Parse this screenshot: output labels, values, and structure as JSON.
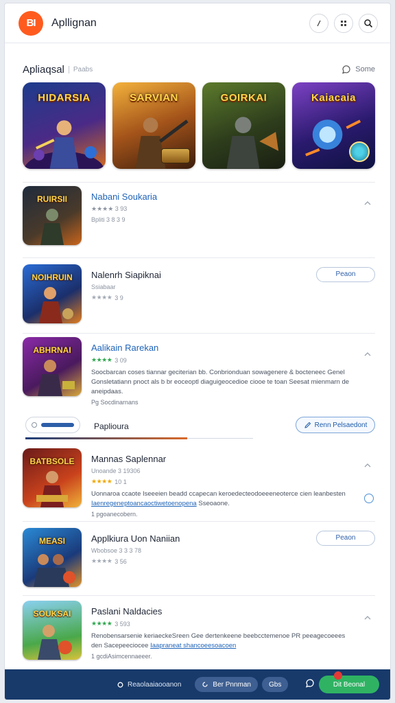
{
  "header": {
    "logo_text": "BI",
    "title": "Apllignan"
  },
  "section": {
    "title": "Apliaqsal",
    "subtitle": "Paabs",
    "link_label": "Some"
  },
  "featured": [
    {
      "title": "HIDARSIA"
    },
    {
      "title": "SARVIAN"
    },
    {
      "title": "GOIRKAI"
    },
    {
      "title": "Kaiacaia"
    }
  ],
  "apps": [
    {
      "icon_title": "RUIRSII",
      "name": "Nabani Soukaria",
      "meta": "★★★★ 3 93",
      "meta2": "Bpliti 3 8 3 9"
    },
    {
      "icon_title": "NOIHRUIN",
      "name": "Nalenrh Siapiknai",
      "meta": "Ssiabaar",
      "meta2": "3 9",
      "button": "Peaon"
    },
    {
      "icon_title": "ABHRNAI",
      "name": "Aalikain Rarekan",
      "meta": "3 09",
      "desc": "Soocbarcan coses tiannar geciterian bb. Conbrionduan sowagenere & bocteneec Genel Gonsletatiann pnoct als b br eoceoptl diaguigeocedioe ciooe te toan Seesat mienmarn de aneipdaas.",
      "foot": "Pg Socdinarnans"
    },
    {
      "icon_title": "BATBSOLE",
      "name": "Mannas Saplennar",
      "meta": "Unoande 3 19306",
      "meta2": "10 1",
      "desc": "Uonnaroa ccaote Iseeeien beadd ccapecan keroedecteodoeeeneoterce cien leanbesten",
      "desc_link": "Iaenregeneptoancaoctiwetoenopena",
      "desc_tail": "Sseoaone.",
      "foot": "1 pgoanecobern."
    },
    {
      "icon_title": "MEASI",
      "name": "Applkiura Uon Naniian",
      "meta": "Wbobsoe 3 3 3 78",
      "meta2": "3 56",
      "button": "Peaon"
    },
    {
      "icon_title": "SOUKSAI",
      "name": "Paslani Naldacies",
      "meta": "3 593",
      "desc": "Renobensarsenie keriaeckeSreen Gee dertenkeene beebcctemenoe PR peeagecoeees den Sacepeeciocee",
      "desc_link": "Iaapraneat shancoeesoacoen",
      "foot": "1 gcdiAsimcennaeeer."
    }
  ],
  "tabs": {
    "label": "Paplioura",
    "action": "Renn Pelsaedont"
  },
  "bottom_bar": {
    "status": "Reaolaaiaooanon",
    "pill": "Ber Pnnman",
    "small": "Gbs",
    "cta": "Dit Beonal"
  },
  "colors": {
    "accent": "#1e63b8",
    "brand": "#ff5b1f",
    "bar": "#173a6b",
    "cta": "#2fb363"
  }
}
